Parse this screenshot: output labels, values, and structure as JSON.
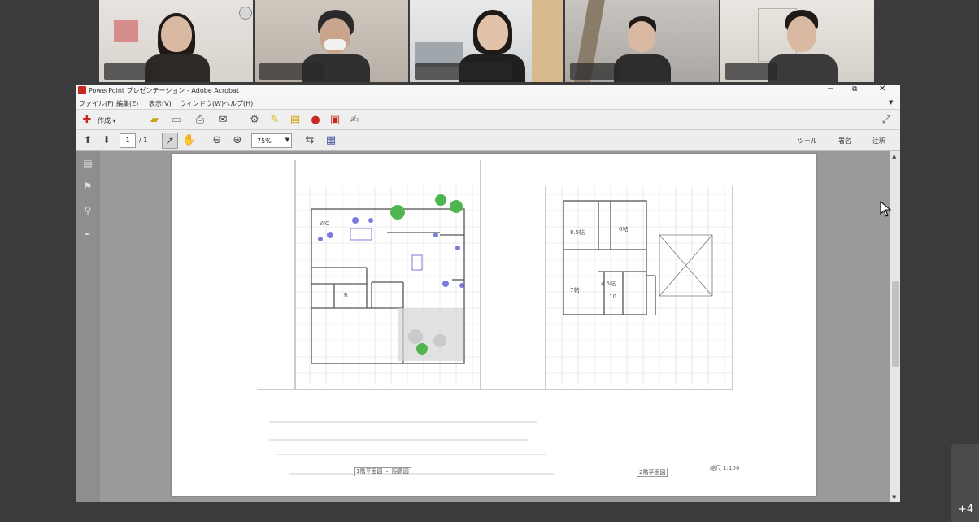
{
  "window": {
    "title": "PowerPoint プレゼンテーション - Adobe Acrobat",
    "minimize": "−",
    "restore": "⧉",
    "close": "✕"
  },
  "menu": {
    "items": [
      "ファイル(F)",
      "編集(E)",
      "表示(V)",
      "ウィンドウ(W)",
      "ヘルプ(H)"
    ]
  },
  "toolbar": {
    "create_label": "作成 ▾",
    "page_current": "1",
    "page_total": "/ 1",
    "zoom_value": "75%",
    "tools_label": "ツール",
    "sign_label": "署名",
    "comment_label": "注釈"
  },
  "participants": {
    "more_count": "+4"
  },
  "drawing": {
    "room_labels": [
      "WC",
      "R",
      "8.5帖",
      "6帖",
      "7帖",
      "4.5帖",
      "10"
    ],
    "caption_left": "1階平面図 ・ 配置図",
    "caption_right": "2階平面図",
    "caption_scale": "縮尺 1:100"
  },
  "colors": {
    "video_bg": "#3b3b3b",
    "acrobat_chrome": "#ececec",
    "doc_bg": "#9a9a9a",
    "furniture_blue": "#5a5ad6",
    "tree_green": "#4fb64f"
  }
}
